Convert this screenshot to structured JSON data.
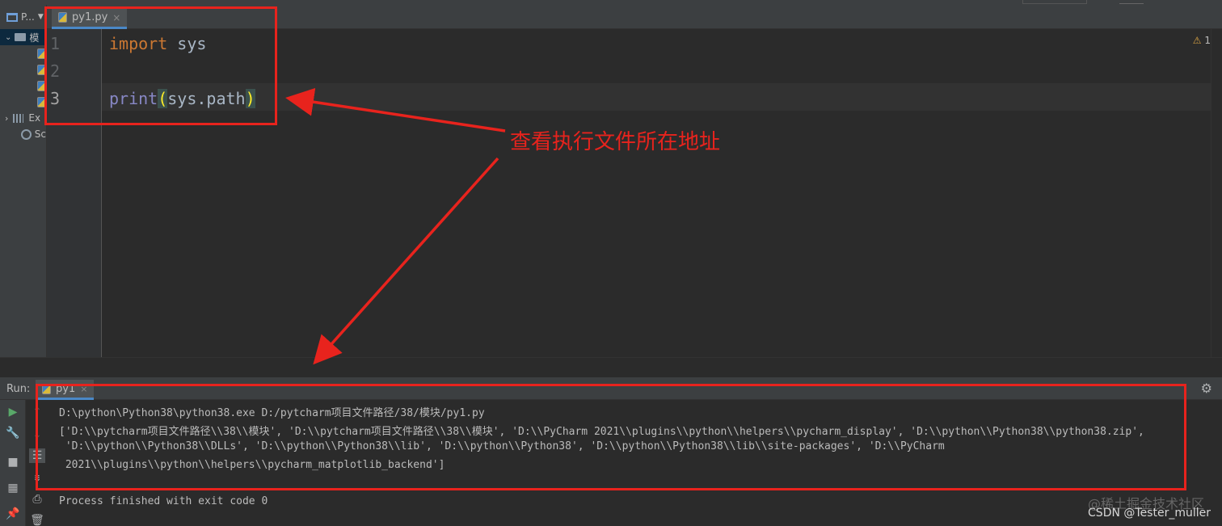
{
  "project_panel": {
    "title": "P...",
    "rows": [
      {
        "label": "模"
      },
      {
        "label": ""
      },
      {
        "label": ""
      },
      {
        "label": ""
      },
      {
        "label": ""
      },
      {
        "label": "Ex"
      },
      {
        "label": "Sc"
      }
    ]
  },
  "editor": {
    "tab_label": "py1.py",
    "warning_count": "1",
    "line_numbers": [
      "1",
      "2",
      "3"
    ],
    "code": {
      "line1_kw": "import",
      "line1_rest": " sys",
      "line3_fn": "print",
      "line3_open": "(",
      "line3_arg": "sys.path",
      "line3_close": ")"
    }
  },
  "run": {
    "label": "Run:",
    "tab_label": "py1",
    "console_lines": [
      "D:\\python\\Python38\\python38.exe D:/pytcharm项目文件路径/38/模块/py1.py",
      "['D:\\\\pytcharm项目文件路径\\\\38\\\\模块', 'D:\\\\pytcharm项目文件路径\\\\38\\\\模块', 'D:\\\\PyCharm 2021\\\\plugins\\\\python\\\\helpers\\\\pycharm_display', 'D:\\\\python\\\\Python38\\\\python38.zip',",
      " 'D:\\\\python\\\\Python38\\\\DLLs', 'D:\\\\python\\\\Python38\\\\lib', 'D:\\\\python\\\\Python38', 'D:\\\\python\\\\Python38\\\\lib\\\\site-packages', 'D:\\\\PyCharm",
      " 2021\\\\plugins\\\\python\\\\helpers\\\\pycharm_matplotlib_backend']",
      "",
      "Process finished with exit code 0"
    ]
  },
  "annotation": {
    "text": "查看执行文件所在地址",
    "color": "#e8231d"
  },
  "watermark": {
    "line1": "@稀土掘金技术社区",
    "line2": "CSDN @Tester_muller"
  }
}
